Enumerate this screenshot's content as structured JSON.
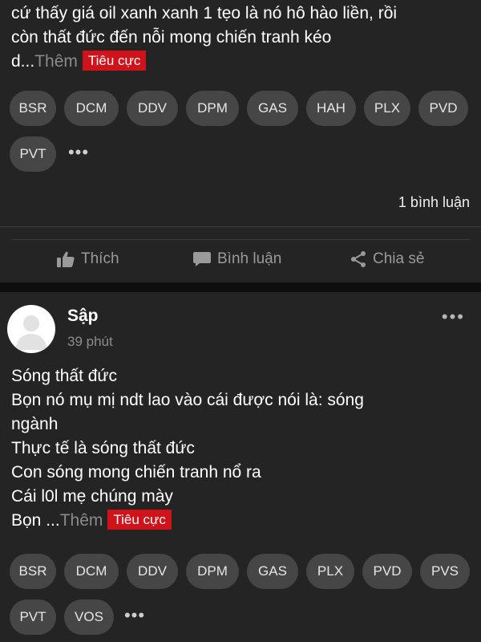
{
  "post1": {
    "body_lines": [
      "cứ thấy giá oil xanh xanh 1 tẹo là nó hô hào liền, rồi",
      "còn thất đức đến nỗi mong chiến tranh kéo"
    ],
    "last_line_text": "d...",
    "more_label": "Thêm",
    "sentiment_tag": "Tiêu cực",
    "tickers": [
      "BSR",
      "DCM",
      "DDV",
      "DPM",
      "GAS",
      "HAH",
      "PLX",
      "PVD",
      "PVT"
    ],
    "more_tickers_label": "•••",
    "comment_count": "1 bình luận"
  },
  "actions": {
    "like_label": "Thích",
    "comment_label": "Bình luận",
    "share_label": "Chia sẻ"
  },
  "post2": {
    "author": "Sập",
    "time": "39 phút",
    "menu_label": "•••",
    "body_lines": [
      "Sóng thất đức",
      "Bọn nó mụ mị ndt lao vào cái được nói là: sóng",
      "ngành",
      "Thực tế là sóng thất đức",
      "Con sóng mong chiến tranh nổ ra",
      "Cái l0l mẹ chúng mày"
    ],
    "last_line_text": "Bọn ...",
    "more_label": "Thêm",
    "sentiment_tag": "Tiêu cực",
    "tickers": [
      "BSR",
      "DCM",
      "DDV",
      "DPM",
      "GAS",
      "PLX",
      "PVD",
      "PVS",
      "PVT",
      "VOS"
    ],
    "more_tickers_label": "•••"
  },
  "icons": [
    "thumbs-up-icon",
    "comment-icon",
    "share-icon",
    "avatar-placeholder-icon",
    "more-dots-icon"
  ],
  "colors": {
    "background": "#242424",
    "chip_bg": "#464646",
    "negative_tag": "#d0121b",
    "muted_text": "#8a8a8a"
  }
}
